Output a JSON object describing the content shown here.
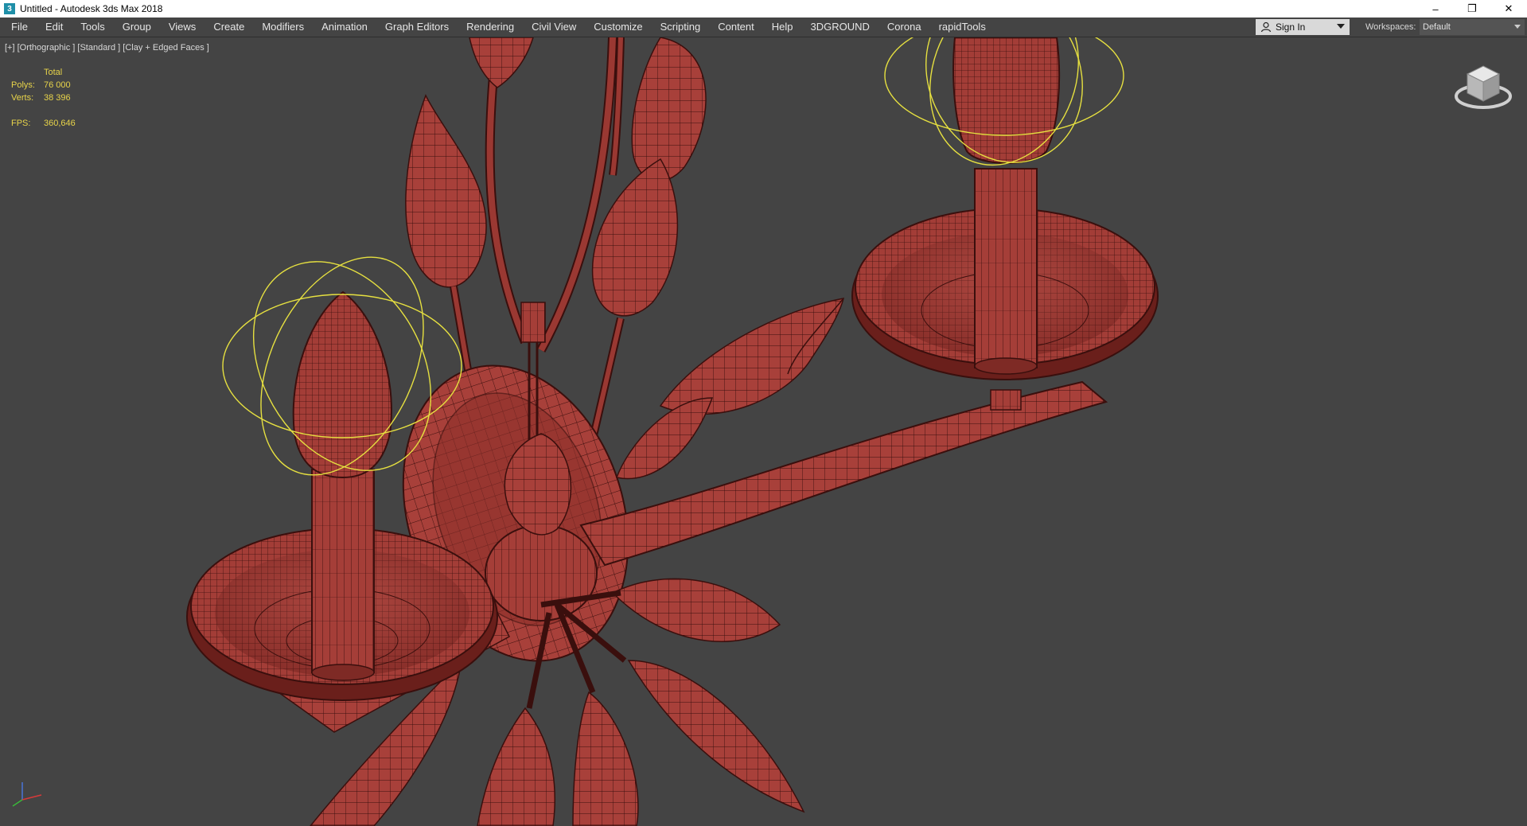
{
  "window": {
    "title": "Untitled - Autodesk 3ds Max 2018",
    "app_icon_glyph": "3",
    "controls": {
      "minimize": "–",
      "restore": "❐",
      "close": "✕"
    }
  },
  "menu": {
    "items": [
      "File",
      "Edit",
      "Tools",
      "Group",
      "Views",
      "Create",
      "Modifiers",
      "Animation",
      "Graph Editors",
      "Rendering",
      "Civil View",
      "Customize",
      "Scripting",
      "Content",
      "Help",
      "3DGROUND",
      "Corona",
      "rapidTools"
    ]
  },
  "account": {
    "sign_in_label": "Sign In"
  },
  "workspaces": {
    "label": "Workspaces:",
    "value": "Default"
  },
  "viewport": {
    "label": "[+] [Orthographic ] [Standard ] [Clay + Edged Faces ]",
    "stats": {
      "total_label": "Total",
      "polys_label": "Polys:",
      "polys_value": "76 000",
      "verts_label": "Verts:",
      "verts_value": "38 396",
      "fps_label": "FPS:",
      "fps_value": "360,646"
    }
  },
  "colors": {
    "viewport_bg": "#444444",
    "model_fill": "#a8403a",
    "wireframe": "#3a0f0d",
    "light_gizmo": "#e6e040",
    "stats_text": "#e8d44a"
  },
  "icons": [
    "app-icon",
    "user-icon",
    "chevron-down-icon",
    "viewcube-icon",
    "axis-tripod-icon",
    "minimize-icon",
    "restore-icon",
    "close-icon"
  ]
}
